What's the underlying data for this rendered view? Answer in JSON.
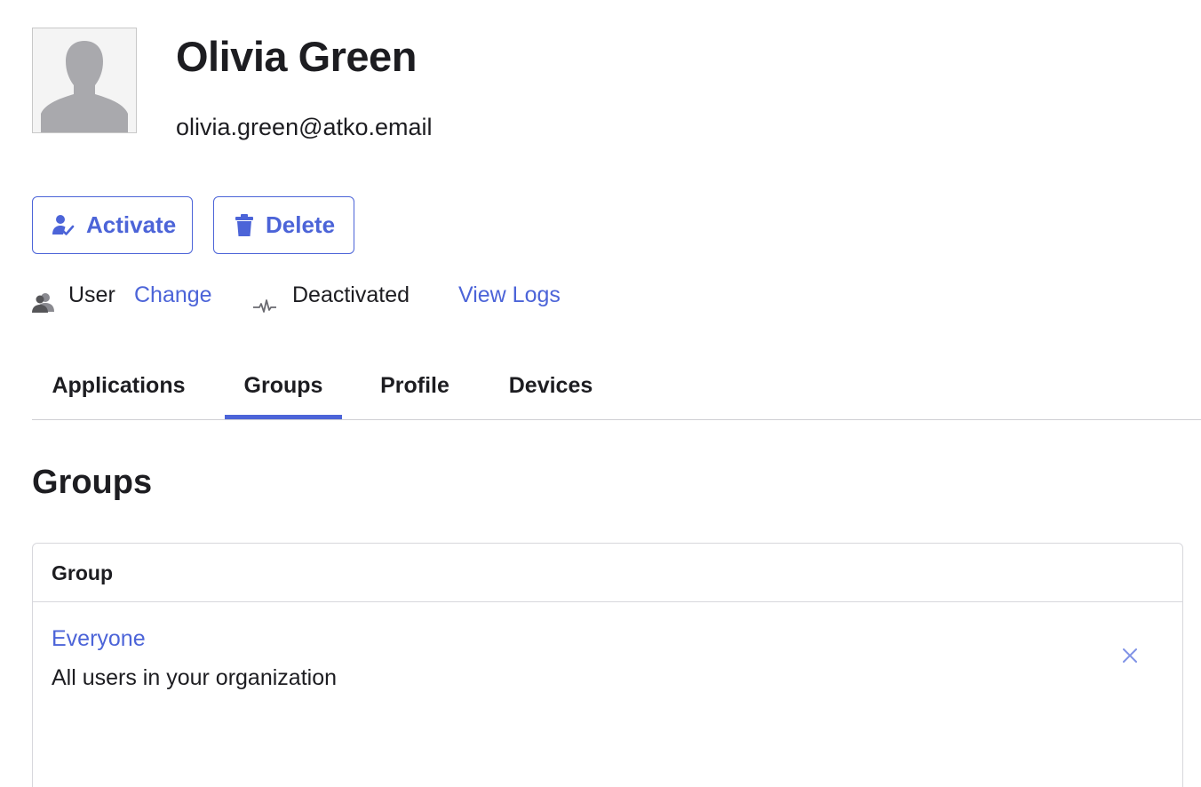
{
  "user": {
    "name": "Olivia Green",
    "email": "olivia.green@atko.email",
    "avatar_icon": "person-silhouette-icon"
  },
  "actions": {
    "activate_label": "Activate",
    "delete_label": "Delete"
  },
  "meta": {
    "role_label": "User",
    "change_link": "Change",
    "status_label": "Deactivated",
    "logs_link": "View Logs"
  },
  "tabs": [
    {
      "label": "Applications",
      "active": false
    },
    {
      "label": "Groups",
      "active": true
    },
    {
      "label": "Profile",
      "active": false
    },
    {
      "label": "Devices",
      "active": false
    }
  ],
  "groups_section": {
    "title": "Groups",
    "column_header": "Group",
    "rows": [
      {
        "name": "Everyone",
        "description": "All users in your organization"
      }
    ]
  },
  "colors": {
    "accent": "#4c64d8",
    "text": "#1d1d21",
    "border": "#d7d7dc"
  }
}
